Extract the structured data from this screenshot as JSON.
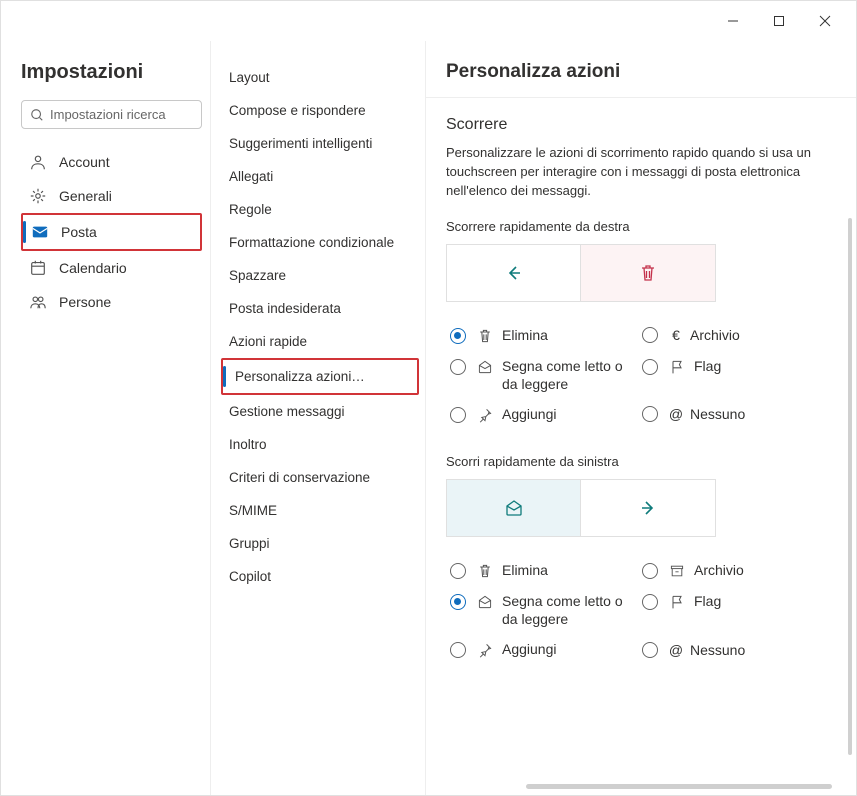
{
  "titlebar": {
    "minimize": "–",
    "maximize": "□",
    "close": "✕"
  },
  "col1": {
    "heading": "Impostazioni",
    "search_placeholder": "Impostazioni ricerca",
    "items": [
      {
        "label": "Account"
      },
      {
        "label": "Generali"
      },
      {
        "label": "Posta"
      },
      {
        "label": "Calendario"
      },
      {
        "label": "Persone"
      }
    ]
  },
  "col2": {
    "items": [
      "Layout",
      "Compose e rispondere",
      "Suggerimenti intelligenti",
      "Allegati",
      "Regole",
      "Formattazione condizionale",
      "Spazzare",
      "Posta indesiderata",
      "Azioni rapide",
      "Personalizza azioni…",
      "Gestione messaggi",
      "Inoltro",
      "Criteri di conservazione",
      "S/MIME",
      "Gruppi",
      "Copilot"
    ]
  },
  "col3": {
    "header": "Personalizza azioni",
    "scorrere_title": "Scorrere",
    "scorrere_desc": "Personalizzare le azioni di scorrimento rapido quando si usa un touchscreen per interagire con i messaggi di posta elettronica nell'elenco dei messaggi.",
    "right_label": "Scorrere rapidamente da destra",
    "left_label": "Scorri rapidamente da sinistra",
    "opts": {
      "elimina": "Elimina",
      "archivio": "Archivio",
      "segna": "Segna come letto o da leggere",
      "segna_b": "Segna come letto o da leggere",
      "flag": "Flag",
      "aggiungi": "Aggiungi",
      "nessuno": "Nessuno"
    }
  }
}
